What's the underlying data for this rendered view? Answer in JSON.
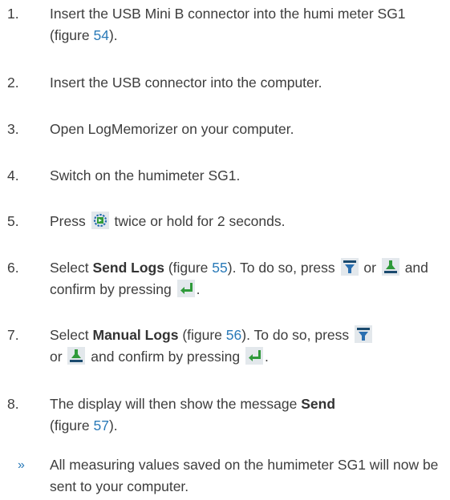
{
  "steps": [
    {
      "num": "1.",
      "pre": "Insert the USB Mini B connector into the humi meter SG1 (figure ",
      "link": "54",
      "post": ")."
    },
    {
      "num": "2.",
      "text": "Insert the USB connector into the computer."
    },
    {
      "num": "3.",
      "text": "Open LogMemorizer on your computer."
    },
    {
      "num": "4.",
      "text": "Switch on the humimeter SG1."
    },
    {
      "num": "5.",
      "pre": "Press ",
      "post": " twice or hold for 2 seconds."
    },
    {
      "num": "6.",
      "pre": "Select ",
      "bold": "Send Logs",
      "mid": " (figure ",
      "link": "55",
      "post1": "). To do so, press ",
      "or": " or ",
      "and": " and confirm by pressing ",
      "end": "."
    },
    {
      "num": "7.",
      "pre": "Select ",
      "bold": "Manual Logs",
      "mid": " (figure ",
      "link": "56",
      "post1": "). To do so, press ",
      "or": "or ",
      "and": " and confirm by pressing ",
      "end": "."
    },
    {
      "num": "8.",
      "pre": "The display will then show the message ",
      "bold": "Send",
      "mid": " (figure ",
      "link": "57",
      "post": ")."
    }
  ],
  "result": {
    "marker": "»",
    "text": "All measuring values saved on the humimeter SG1 will now be sent to your computer."
  },
  "icons": {
    "menu": "menu-rotate-icon",
    "down": "arrow-down-icon",
    "up": "arrow-up-icon",
    "enter": "enter-icon"
  },
  "colors": {
    "link": "#2a7ab8",
    "text": "#3d3d3d",
    "icon_green": "#2f9a3a",
    "icon_blue": "#2a6fb0",
    "icon_dark": "#1a4a6e"
  }
}
